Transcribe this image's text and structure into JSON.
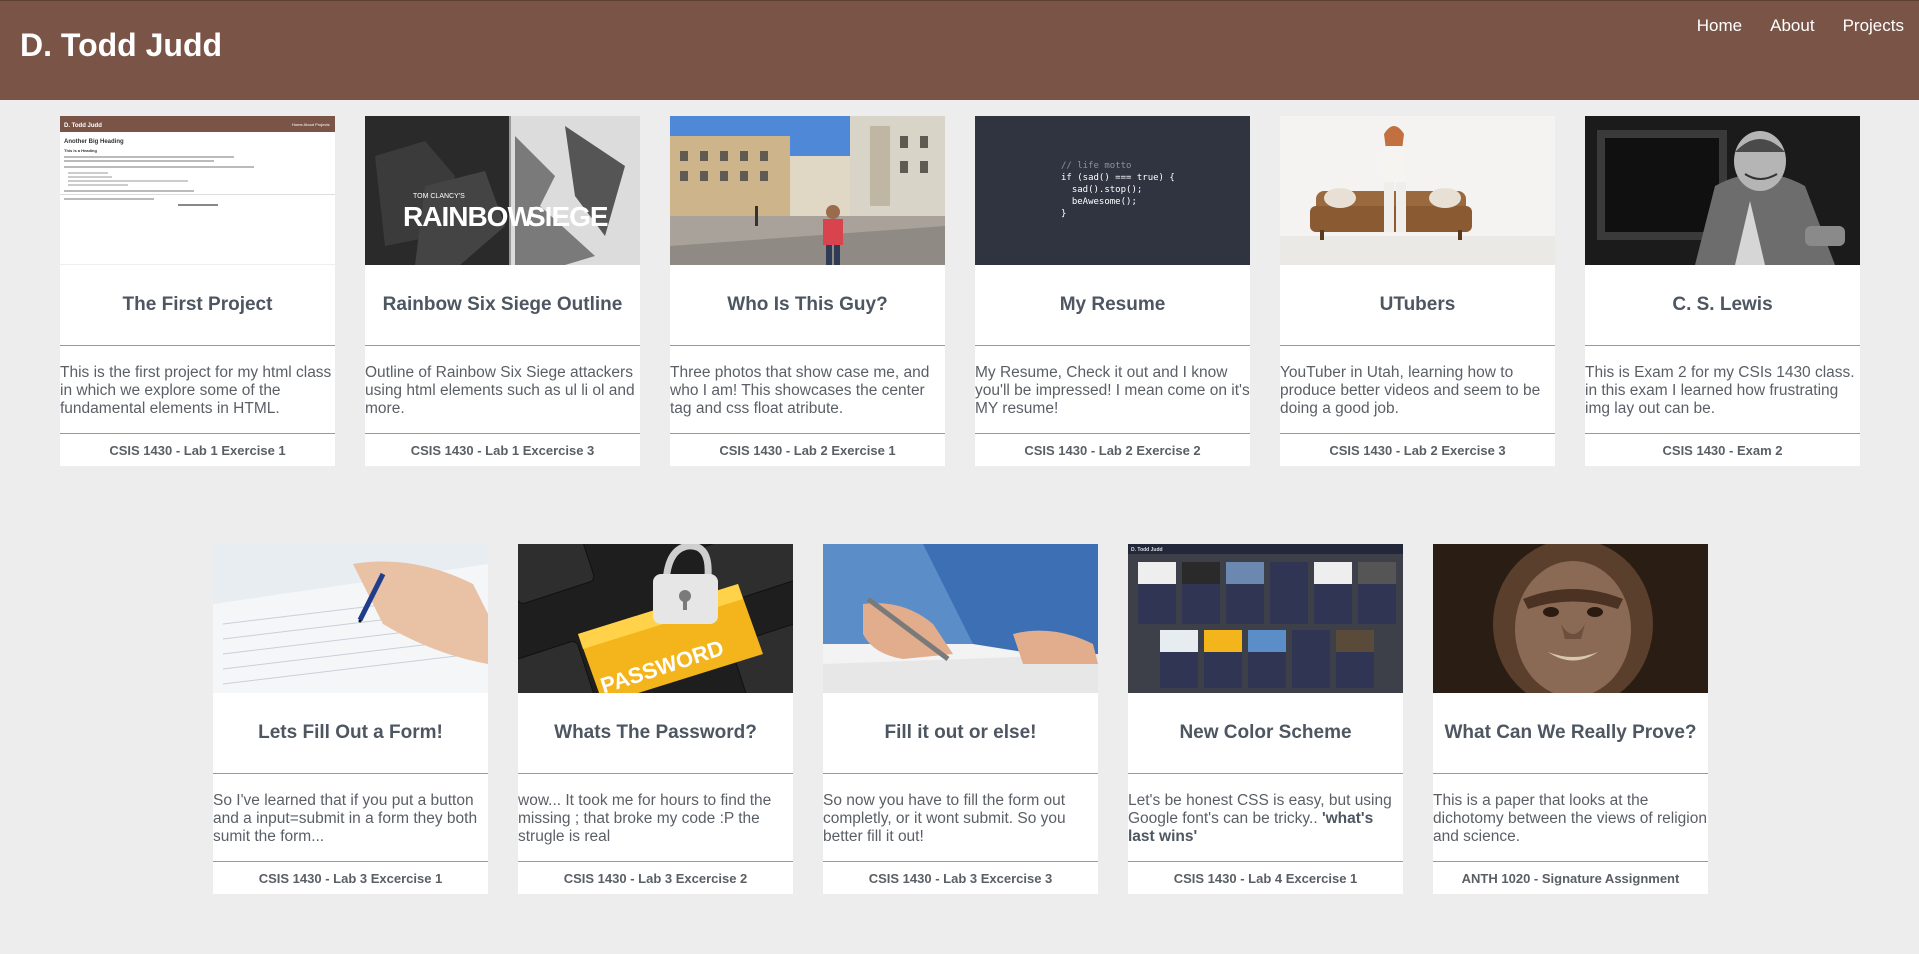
{
  "header": {
    "site_title": "D. Todd Judd",
    "nav": [
      "Home",
      "About",
      "Projects"
    ]
  },
  "cards": [
    {
      "title": "The First Project",
      "description": "This is the first project for my html class in which we explore some of the fundamental elements in HTML.",
      "course": "CSIS 1430 - Lab 1 Exercise 1",
      "image": "first-project-screenshot"
    },
    {
      "title": "Rainbow Six Siege Outline",
      "description": "Outline of Rainbow Six Siege attackers using html elements such as ul li ol and more.",
      "course": "CSIS 1430 - Lab 1 Excercise 3",
      "image": "rainbow-six-siege-logo"
    },
    {
      "title": "Who Is This Guy?",
      "description": "Three photos that show case me, and who I am! This showcases the center tag and css float atribute.",
      "course": "CSIS 1430 - Lab 2 Exercise 1",
      "image": "street-photo"
    },
    {
      "title": "My Resume",
      "description": "My Resume, Check it out and I know you'll be impressed! I mean come on it's MY resume!",
      "course": "CSIS 1430 - Lab 2 Exercise 2",
      "image": "code-motto",
      "code_lines": [
        "// life motto",
        "if (sad() === true) {",
        "  sad().stop();",
        "  beAwesome();",
        "}"
      ]
    },
    {
      "title": "UTubers",
      "description": "YouTuber in Utah, learning how to produce better videos and seem to be doing a good job.",
      "course": "CSIS 1430 - Lab 2 Exercise 3",
      "image": "woman-on-couch"
    },
    {
      "title": "C. S. Lewis",
      "description": "This is Exam 2 for my CSIs 1430 class. in this exam I learned how frustrating img lay out can be.",
      "course": "CSIS 1430 - Exam 2",
      "image": "cs-lewis-portrait"
    },
    {
      "title": "Lets Fill Out a Form!",
      "description": "So I've learned that if you put a button and a input=submit in a form they both sumit the form...",
      "course": "CSIS 1430 - Lab 3 Excercise 1",
      "image": "hand-writing-form"
    },
    {
      "title": "Whats The Password?",
      "description": "wow... It took me for hours to find the missing ; that broke my code :P the strugle is real",
      "course": "CSIS 1430 - Lab 3 Excercise 2",
      "image": "password-key",
      "key_label": "PASSWORD"
    },
    {
      "title": "Fill it out or else!",
      "description": "So now you have to fill the form out completly, or it wont submit. So you better fill it out!",
      "course": "CSIS 1430 - Lab 3 Excercise 3",
      "image": "hand-signing"
    },
    {
      "title": "New Color Scheme",
      "description_plain": "Let's be honest CSS is easy, but using Google font's can be tricky.. ",
      "description_bold": "'what's last wins'",
      "course": "CSIS 1430 - Lab 4 Excercise 1",
      "image": "dark-site-screenshot"
    },
    {
      "title": "What Can We Really Prove?",
      "description": "This is a paper that looks at the dichotomy between the views of religion and science.",
      "course": "ANTH 1020 - Signature Assignment",
      "image": "hominid-face"
    }
  ],
  "colors": {
    "header_bg": "#7a5446",
    "page_bg": "#ededed",
    "card_bg": "#ffffff",
    "title_text": "#4d5661"
  }
}
